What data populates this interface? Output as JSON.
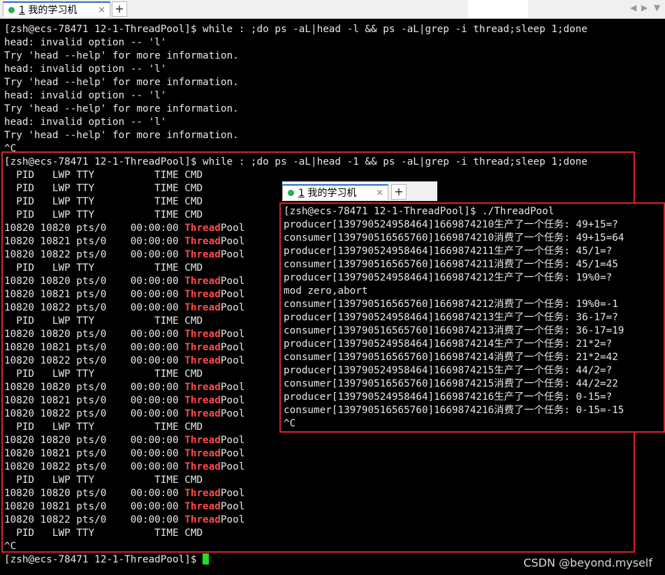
{
  "tabbar": {
    "tab_number": "1",
    "tab_title": "我的学习机",
    "close_glyph": "×",
    "add_glyph": "+",
    "nav_left": "◀",
    "nav_right": "▶",
    "menu_glyph": "▼"
  },
  "terminal": {
    "lines": [
      [
        {
          "t": "[zsh@ecs-78471 12-1-ThreadPool]$ while : ;do ps -aL|head -l && ps -aL|grep -i thread;sleep 1;done"
        }
      ],
      [
        {
          "t": "head: invalid option -- 'l'"
        }
      ],
      [
        {
          "t": "Try 'head --help' for more information."
        }
      ],
      [
        {
          "t": "head: invalid option -- 'l'"
        }
      ],
      [
        {
          "t": "Try 'head --help' for more information."
        }
      ],
      [
        {
          "t": "head: invalid option -- 'l'"
        }
      ],
      [
        {
          "t": "Try 'head --help' for more information."
        }
      ],
      [
        {
          "t": "head: invalid option -- 'l'"
        }
      ],
      [
        {
          "t": "Try 'head --help' for more information."
        }
      ],
      [
        {
          "t": "^C"
        }
      ],
      [
        {
          "t": "[zsh@ecs-78471 12-1-ThreadPool]$ while : ;do ps -aL|head -1 && ps -aL|grep -i thread;sleep 1;done"
        }
      ],
      [
        {
          "t": "  PID   LWP TTY          TIME CMD"
        }
      ],
      [
        {
          "t": "  PID   LWP TTY          TIME CMD"
        }
      ],
      [
        {
          "t": "  PID   LWP TTY          TIME CMD"
        }
      ],
      [
        {
          "t": "  PID   LWP TTY          TIME CMD"
        }
      ],
      [
        {
          "t": "10820 10820 pts/0    00:00:00 "
        },
        {
          "t": "Thread",
          "hl": true
        },
        {
          "t": "Pool"
        }
      ],
      [
        {
          "t": "10820 10821 pts/0    00:00:00 "
        },
        {
          "t": "Thread",
          "hl": true
        },
        {
          "t": "Pool"
        }
      ],
      [
        {
          "t": "10820 10822 pts/0    00:00:00 "
        },
        {
          "t": "Thread",
          "hl": true
        },
        {
          "t": "Pool"
        }
      ],
      [
        {
          "t": "  PID   LWP TTY          TIME CMD"
        }
      ],
      [
        {
          "t": "10820 10820 pts/0    00:00:00 "
        },
        {
          "t": "Thread",
          "hl": true
        },
        {
          "t": "Pool"
        }
      ],
      [
        {
          "t": "10820 10821 pts/0    00:00:00 "
        },
        {
          "t": "Thread",
          "hl": true
        },
        {
          "t": "Pool"
        }
      ],
      [
        {
          "t": "10820 10822 pts/0    00:00:00 "
        },
        {
          "t": "Thread",
          "hl": true
        },
        {
          "t": "Pool"
        }
      ],
      [
        {
          "t": "  PID   LWP TTY          TIME CMD"
        }
      ],
      [
        {
          "t": "10820 10820 pts/0    00:00:00 "
        },
        {
          "t": "Thread",
          "hl": true
        },
        {
          "t": "Pool"
        }
      ],
      [
        {
          "t": "10820 10821 pts/0    00:00:00 "
        },
        {
          "t": "Thread",
          "hl": true
        },
        {
          "t": "Pool"
        }
      ],
      [
        {
          "t": "10820 10822 pts/0    00:00:00 "
        },
        {
          "t": "Thread",
          "hl": true
        },
        {
          "t": "Pool"
        }
      ],
      [
        {
          "t": "  PID   LWP TTY          TIME CMD"
        }
      ],
      [
        {
          "t": "10820 10820 pts/0    00:00:00 "
        },
        {
          "t": "Thread",
          "hl": true
        },
        {
          "t": "Pool"
        }
      ],
      [
        {
          "t": "10820 10821 pts/0    00:00:00 "
        },
        {
          "t": "Thread",
          "hl": true
        },
        {
          "t": "Pool"
        }
      ],
      [
        {
          "t": "10820 10822 pts/0    00:00:00 "
        },
        {
          "t": "Thread",
          "hl": true
        },
        {
          "t": "Pool"
        }
      ],
      [
        {
          "t": "  PID   LWP TTY          TIME CMD"
        }
      ],
      [
        {
          "t": "10820 10820 pts/0    00:00:00 "
        },
        {
          "t": "Thread",
          "hl": true
        },
        {
          "t": "Pool"
        }
      ],
      [
        {
          "t": "10820 10821 pts/0    00:00:00 "
        },
        {
          "t": "Thread",
          "hl": true
        },
        {
          "t": "Pool"
        }
      ],
      [
        {
          "t": "10820 10822 pts/0    00:00:00 "
        },
        {
          "t": "Thread",
          "hl": true
        },
        {
          "t": "Pool"
        }
      ],
      [
        {
          "t": "  PID   LWP TTY          TIME CMD"
        }
      ],
      [
        {
          "t": "10820 10820 pts/0    00:00:00 "
        },
        {
          "t": "Thread",
          "hl": true
        },
        {
          "t": "Pool"
        }
      ],
      [
        {
          "t": "10820 10821 pts/0    00:00:00 "
        },
        {
          "t": "Thread",
          "hl": true
        },
        {
          "t": "Pool"
        }
      ],
      [
        {
          "t": "10820 10822 pts/0    00:00:00 "
        },
        {
          "t": "Thread",
          "hl": true
        },
        {
          "t": "Pool"
        }
      ],
      [
        {
          "t": "  PID   LWP TTY          TIME CMD"
        }
      ],
      [
        {
          "t": "^C"
        }
      ]
    ],
    "prompt": "[zsh@ecs-78471 12-1-ThreadPool]$ "
  },
  "overlay": {
    "tab_number": "1",
    "tab_title": "我的学习机",
    "close_glyph": "×",
    "add_glyph": "+",
    "lines": [
      "[zsh@ecs-78471 12-1-ThreadPool]$ ./ThreadPool",
      "producer[139790524958464]1669874210生产了一个任务: 49+15=?",
      "consumer[139790516565760]1669874210消费了一个任务: 49+15=64",
      "producer[139790524958464]1669874211生产了一个任务: 45/1=?",
      "consumer[139790516565760]1669874211消费了一个任务: 45/1=45",
      "producer[139790524958464]1669874212生产了一个任务: 19%0=?",
      "mod zero,abort",
      "consumer[139790516565760]1669874212消费了一个任务: 19%0=-1",
      "producer[139790524958464]1669874213生产了一个任务: 36-17=?",
      "consumer[139790516565760]1669874213消费了一个任务: 36-17=19",
      "producer[139790524958464]1669874214生产了一个任务: 21*2=?",
      "consumer[139790516565760]1669874214消费了一个任务: 21*2=42",
      "producer[139790524958464]1669874215生产了一个任务: 44/2=?",
      "consumer[139790516565760]1669874215消费了一个任务: 44/2=22",
      "producer[139790524958464]1669874216生产了一个任务: 0-15=?",
      "consumer[139790516565760]1669874216消费了一个任务: 0-15=-15",
      "^C"
    ]
  },
  "watermark": "CSDN @beyond.myself",
  "colors": {
    "highlight": "#ff4b4b",
    "annotation": "#d8232a",
    "cursor": "#22e022",
    "status_dot": "#22b14c"
  }
}
